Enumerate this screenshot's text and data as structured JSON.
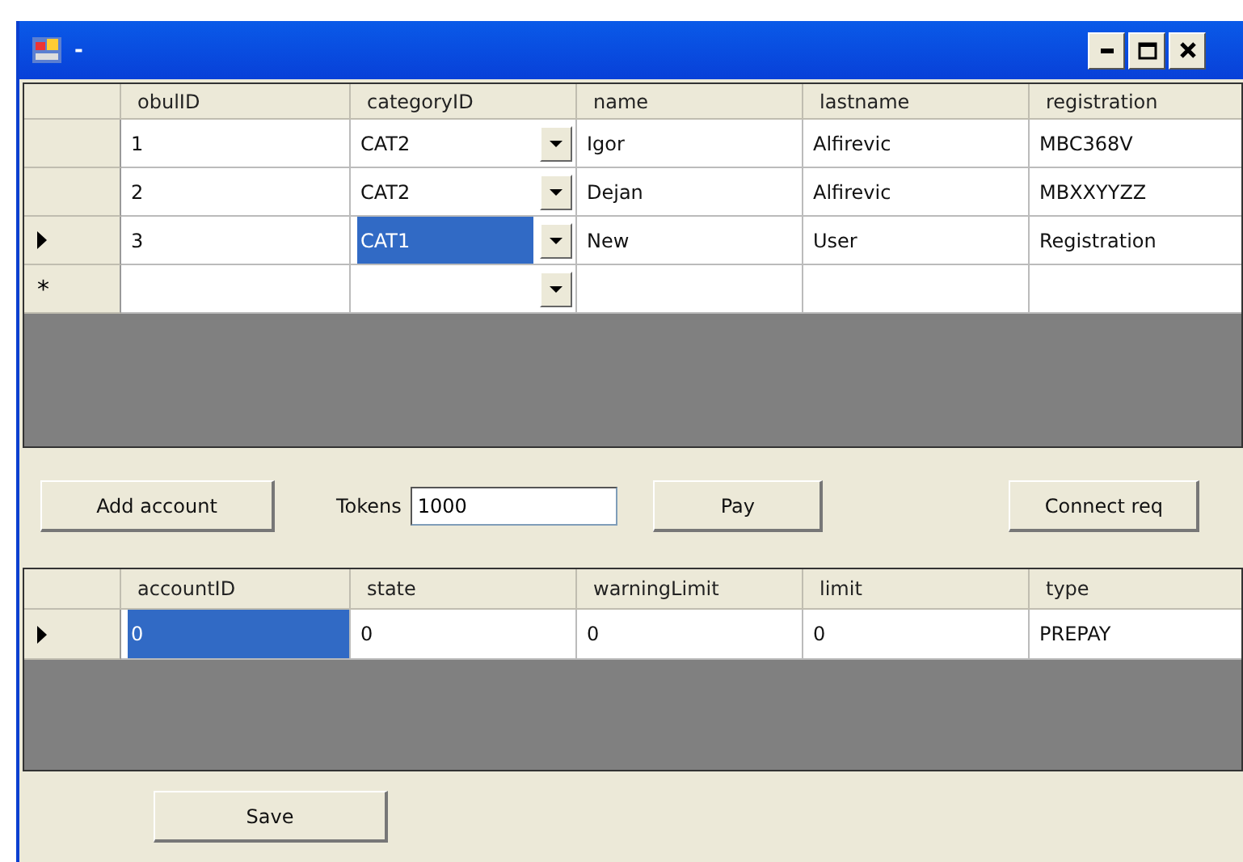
{
  "window": {
    "title": "-"
  },
  "accounts_grid": {
    "columns": [
      {
        "label": "obulID",
        "kind": "text"
      },
      {
        "label": "categoryID",
        "kind": "combo"
      },
      {
        "label": "name",
        "kind": "text"
      },
      {
        "label": "lastname",
        "kind": "text"
      },
      {
        "label": "registration",
        "kind": "text"
      }
    ],
    "rows": [
      {
        "kind": "data",
        "current": false,
        "cells": [
          {
            "text": "1",
            "selected": false
          },
          {
            "text": "CAT2",
            "selected": false
          },
          {
            "text": "Igor",
            "selected": false
          },
          {
            "text": "Alfirevic",
            "selected": false
          },
          {
            "text": "MBC368V",
            "selected": false
          }
        ]
      },
      {
        "kind": "data",
        "current": false,
        "cells": [
          {
            "text": "2",
            "selected": false
          },
          {
            "text": "CAT2",
            "selected": false
          },
          {
            "text": "Dejan",
            "selected": false
          },
          {
            "text": "Alfirevic",
            "selected": false
          },
          {
            "text": "MBXXYYZZ",
            "selected": false
          }
        ]
      },
      {
        "kind": "data",
        "current": true,
        "cells": [
          {
            "text": "3",
            "selected": false
          },
          {
            "text": "CAT1",
            "selected": true
          },
          {
            "text": "New",
            "selected": false
          },
          {
            "text": "User",
            "selected": false
          },
          {
            "text": "Registration",
            "selected": false
          }
        ]
      },
      {
        "kind": "new",
        "marker": "*",
        "cells": [
          {
            "text": "",
            "selected": false
          },
          {
            "text": "",
            "selected": false
          },
          {
            "text": "",
            "selected": false
          },
          {
            "text": "",
            "selected": false
          },
          {
            "text": "",
            "selected": false
          }
        ]
      }
    ]
  },
  "toolbar": {
    "add_button": "Add account",
    "tokens_label": "Tokens",
    "tokens_value": "1000",
    "pay_button": "Pay",
    "connect_button": "Connect req"
  },
  "details_grid": {
    "columns": [
      {
        "label": "accountID"
      },
      {
        "label": "state"
      },
      {
        "label": "warningLimit"
      },
      {
        "label": "limit"
      },
      {
        "label": "type"
      }
    ],
    "rows": [
      {
        "current": true,
        "cells": [
          {
            "text": "0",
            "selected": true
          },
          {
            "text": "0",
            "selected": false
          },
          {
            "text": "0",
            "selected": false
          },
          {
            "text": "0",
            "selected": false
          },
          {
            "text": "PREPAY",
            "selected": false
          }
        ]
      }
    ]
  },
  "save_button": "Save"
}
